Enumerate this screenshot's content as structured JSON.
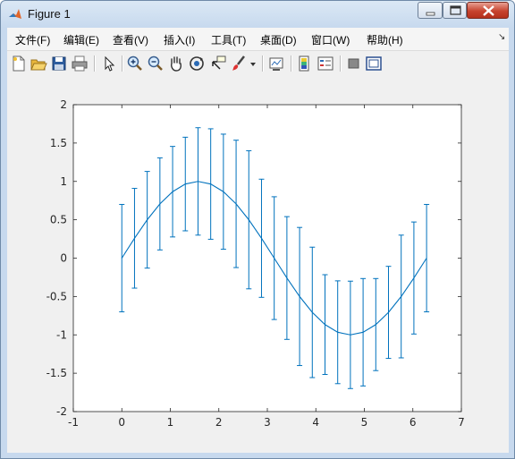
{
  "window": {
    "title": "Figure 1",
    "minimize_icon": "minimize-icon",
    "maximize_icon": "maximize-icon",
    "close_icon": "close-icon"
  },
  "menu": {
    "items": [
      "文件(F)",
      "编辑(E)",
      "查看(V)",
      "插入(I)",
      "工具(T)",
      "桌面(D)",
      "窗口(W)",
      "帮助(H)"
    ]
  },
  "toolbar": {
    "icons": [
      "new-figure-icon",
      "open-file-icon",
      "save-icon",
      "print-icon",
      "edit-plot-arrow-icon",
      "zoom-in-icon",
      "zoom-out-icon",
      "pan-hand-icon",
      "rotate-3d-icon",
      "data-cursor-icon",
      "brush-icon",
      "link-plot-icon",
      "colorbar-icon",
      "legend-icon",
      "hide-plot-tools-icon",
      "show-plot-tools-icon"
    ]
  },
  "colors": {
    "series": "#0072bd",
    "axes": "#262626",
    "figure_bg": "#f0f0f0"
  },
  "chart_data": {
    "type": "line",
    "title": "",
    "xlabel": "",
    "ylabel": "",
    "xlim": [
      -1,
      7
    ],
    "ylim": [
      -2,
      2
    ],
    "xticks": [
      "-1",
      "0",
      "1",
      "2",
      "3",
      "4",
      "5",
      "6",
      "7"
    ],
    "yticks": [
      "2",
      "1.5",
      "1",
      "0.5",
      "0",
      "-0.5",
      "-1",
      "-1.5",
      "-2"
    ],
    "grid": false,
    "series": [
      {
        "x": [
          0,
          0.2618,
          0.5236,
          0.7854,
          1.0472,
          1.309,
          1.5708,
          1.8326,
          2.0944,
          2.3562,
          2.618,
          2.8798,
          3.1416,
          3.4034,
          3.6652,
          3.927,
          4.1888,
          4.4506,
          4.7124,
          4.9742,
          5.236,
          5.4978,
          5.7596,
          6.0214,
          6.2832
        ],
        "y": [
          0,
          0.259,
          0.5,
          0.707,
          0.866,
          0.966,
          1.0,
          0.966,
          0.866,
          0.707,
          0.5,
          0.259,
          0,
          -0.259,
          -0.5,
          -0.707,
          -0.866,
          -0.966,
          -1.0,
          -0.966,
          -0.866,
          -0.707,
          -0.5,
          -0.259,
          0
        ],
        "error": [
          0.7,
          0.65,
          0.63,
          0.6,
          0.59,
          0.61,
          0.7,
          0.72,
          0.75,
          0.83,
          0.9,
          0.77,
          0.8,
          0.8,
          0.9,
          0.85,
          0.65,
          0.67,
          0.7,
          0.7,
          0.6,
          0.6,
          0.8,
          0.73,
          0.7
        ]
      }
    ]
  }
}
